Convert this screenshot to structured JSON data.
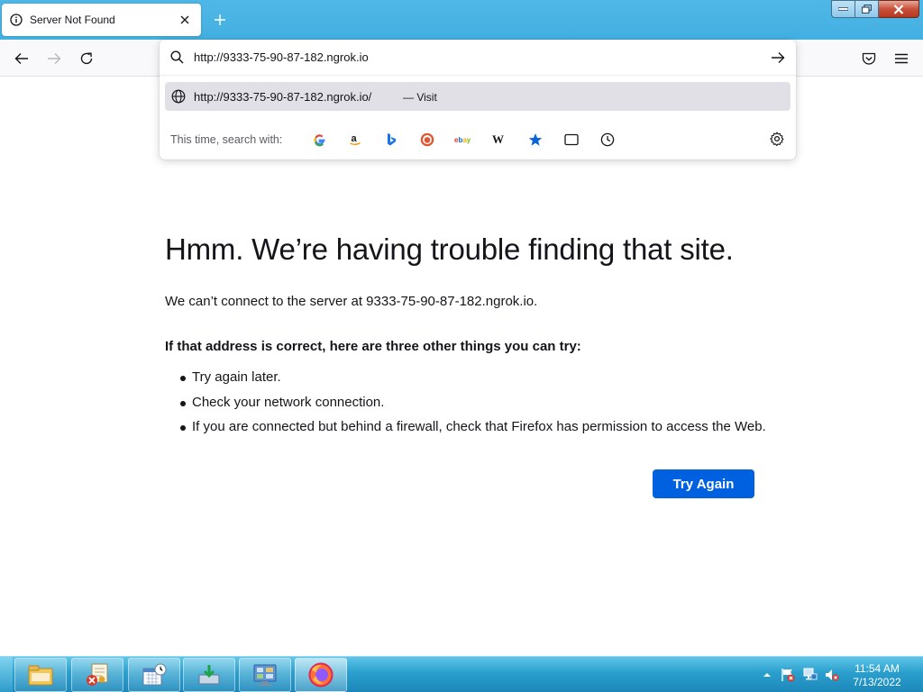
{
  "tab": {
    "title": "Server Not Found"
  },
  "urlbar": {
    "value": "http://9333-75-90-87-182.ngrok.io",
    "suggestion_url": "http://9333-75-90-87-182.ngrok.io/",
    "suggestion_action": "— Visit",
    "search_with_label": "This time, search with:"
  },
  "search_engines": [
    "google-icon",
    "amazon-icon",
    "bing-icon",
    "duckduckgo-icon",
    "ebay-icon",
    "wikipedia-icon",
    "bookmarks-icon",
    "tabs-icon",
    "history-icon"
  ],
  "error": {
    "title": "Hmm. We’re having trouble finding that site.",
    "description": "We can’t connect to the server at 9333-75-90-87-182.ngrok.io.",
    "subheading": "If that address is correct, here are three other things you can try:",
    "tips": [
      "Try again later.",
      "Check your network connection.",
      "If you are connected but behind a firewall, check that Firefox has permission to access the Web."
    ],
    "button_label": "Try Again"
  },
  "taskbar": {
    "time": "11:54 AM",
    "date": "7/13/2022",
    "apps": [
      "file-explorer-icon",
      "certificate-icon",
      "calendar-clock-icon",
      "download-icon",
      "control-panel-icon",
      "firefox-icon"
    ]
  },
  "colors": {
    "accent": "#0061e0",
    "titlebar": "#43b0e2",
    "taskbar": "#2a9fcd"
  }
}
